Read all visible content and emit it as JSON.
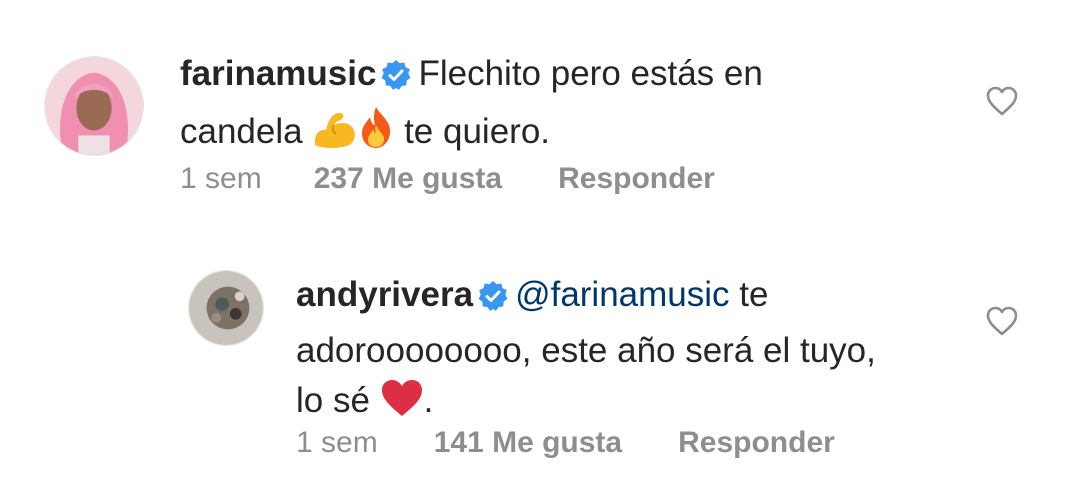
{
  "comments": [
    {
      "username": "farinamusic",
      "text_line1": "Flechito pero estás en",
      "text_line2a": "candela",
      "text_line2b": "te quiero.",
      "emoji_names": [
        "flexed-biceps-icon",
        "fire-icon"
      ],
      "time": "1 sem",
      "likes": "237 Me gusta",
      "reply": "Responder"
    },
    {
      "username": "andyrivera",
      "mention": "@farinamusic",
      "text_line1_suffix": "te",
      "text_line2": "adoroooooooo, este año será el tuyo,",
      "text_line3a": "lo sé",
      "text_line3b": ".",
      "emoji_names": [
        "red-heart-icon"
      ],
      "time": "1 sem",
      "likes": "141 Me gusta",
      "reply": "Responder"
    }
  ],
  "colors": {
    "text": "#262626",
    "meta": "#8e8e8e",
    "mention": "#00376b",
    "verified": "#3897f0"
  }
}
